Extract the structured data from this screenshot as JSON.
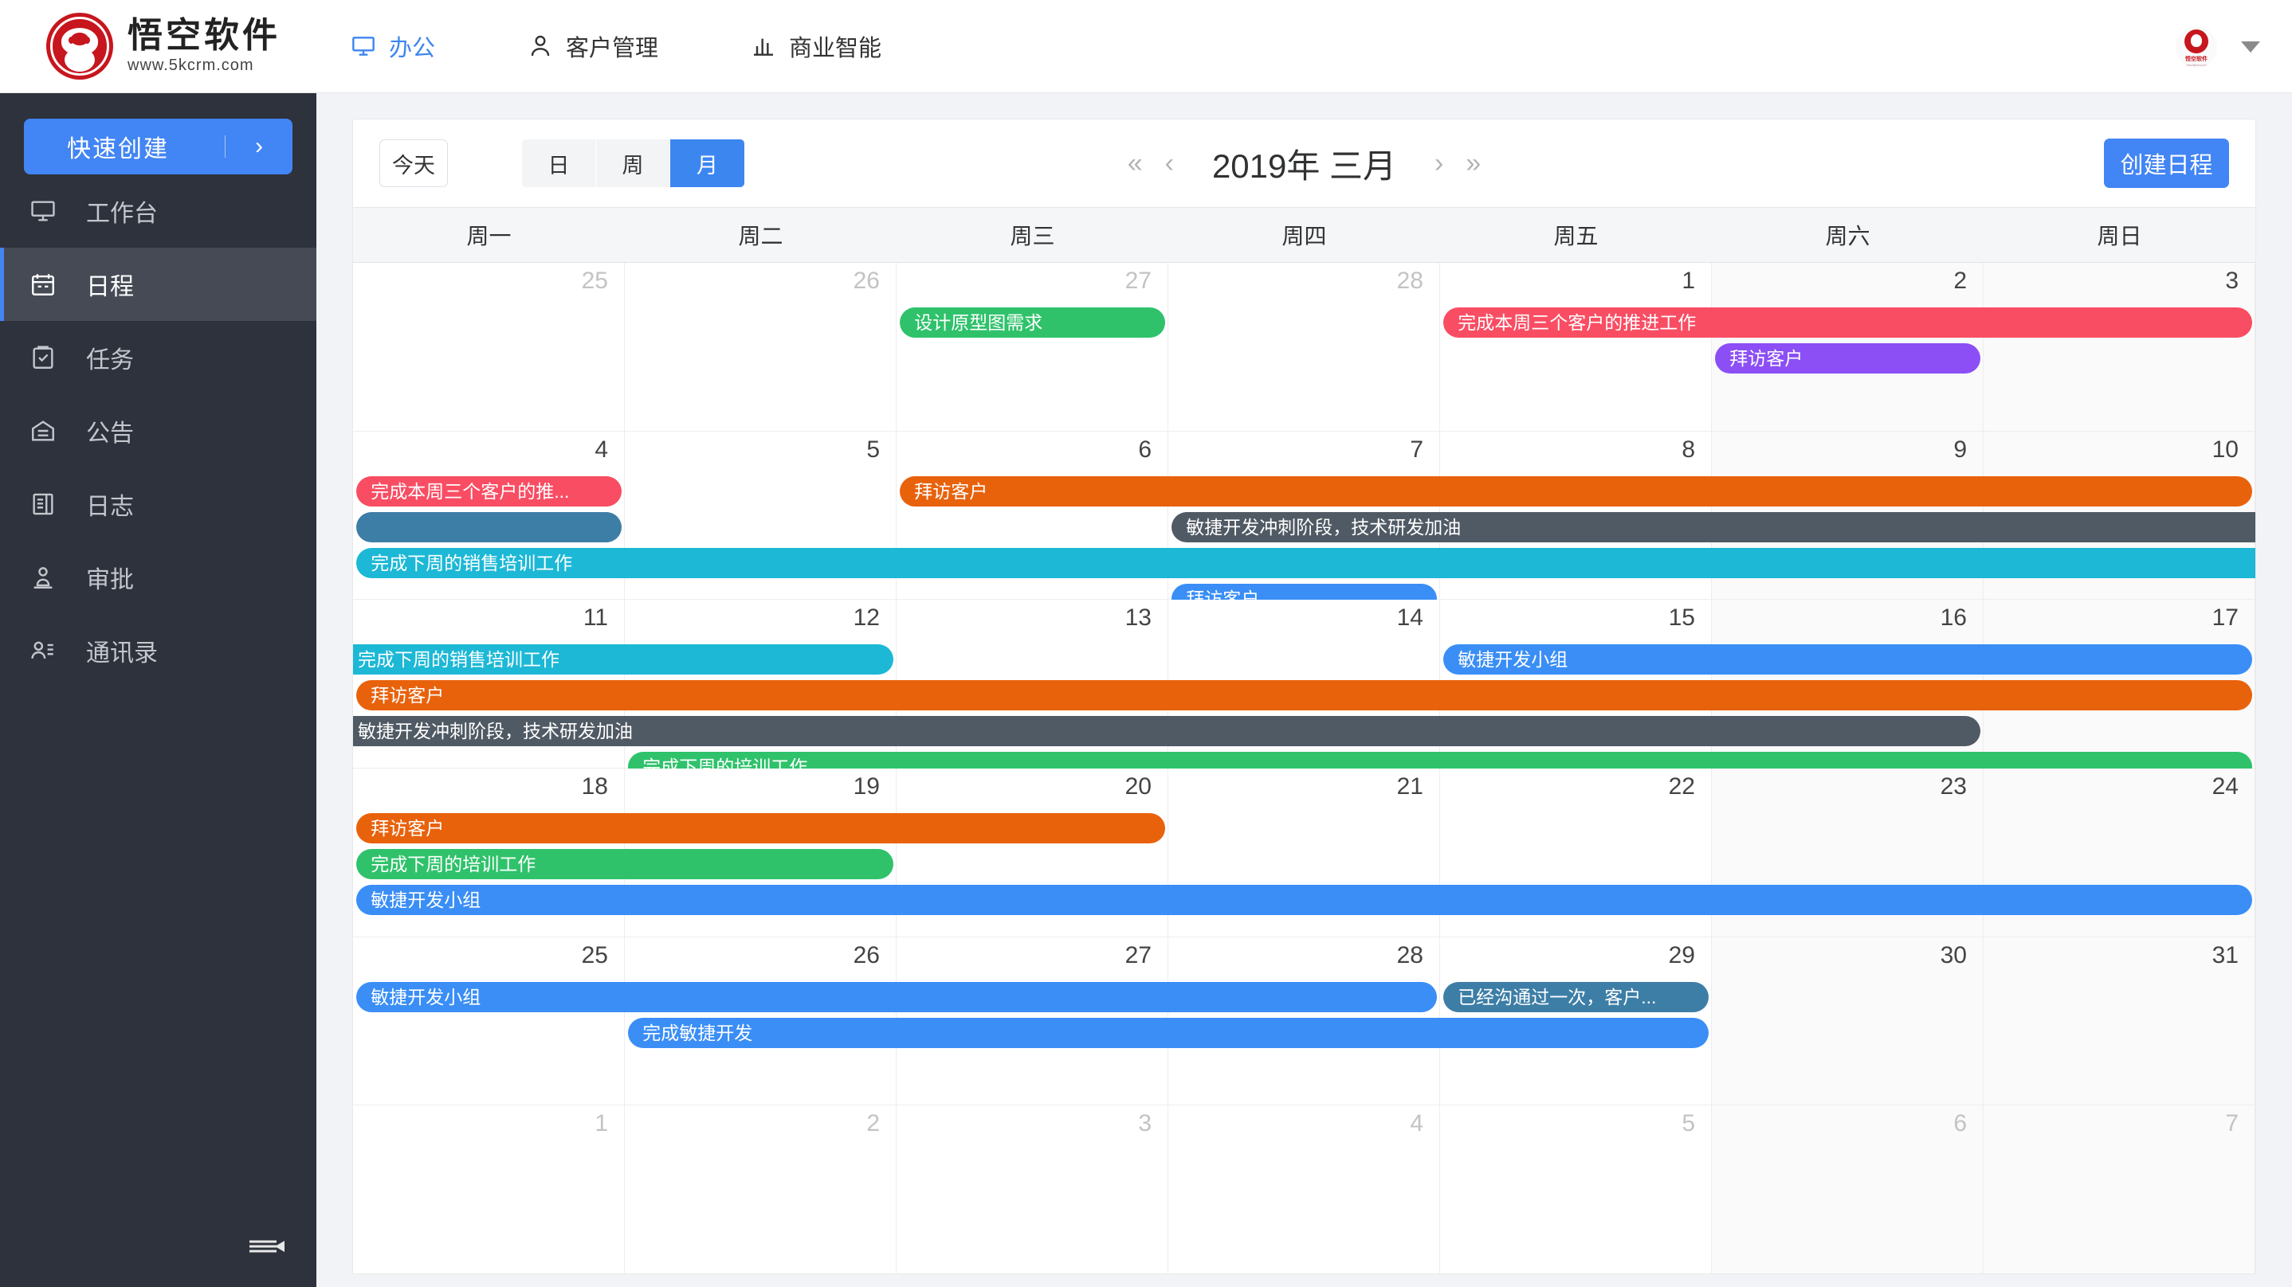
{
  "brand": {
    "name": "悟空软件",
    "url": "www.5kcrm.com",
    "logo_color": "#c7161e"
  },
  "topnav": {
    "items": [
      {
        "label": "办公",
        "icon": "monitor-icon",
        "active": true
      },
      {
        "label": "客户管理",
        "icon": "user-icon",
        "active": false
      },
      {
        "label": "商业智能",
        "icon": "bar-chart-icon",
        "active": false
      }
    ],
    "avatar_label": "悟空软件",
    "avatar_url": "www.5kcrm.com"
  },
  "sidebar": {
    "quick_create": {
      "label": "快速创建",
      "arrow": "›"
    },
    "items": [
      {
        "label": "工作台",
        "icon": "monitor-icon",
        "active": false
      },
      {
        "label": "日程",
        "icon": "calendar-icon",
        "active": true
      },
      {
        "label": "任务",
        "icon": "clipboard-check-icon",
        "active": false
      },
      {
        "label": "公告",
        "icon": "announcement-icon",
        "active": false
      },
      {
        "label": "日志",
        "icon": "journal-icon",
        "active": false
      },
      {
        "label": "审批",
        "icon": "stamp-icon",
        "active": false
      },
      {
        "label": "通讯录",
        "icon": "contacts-icon",
        "active": false
      }
    ],
    "collapse_icon": "collapse-sidebar-icon"
  },
  "toolbar": {
    "today_label": "今天",
    "views": [
      {
        "label": "日",
        "active": false
      },
      {
        "label": "周",
        "active": false
      },
      {
        "label": "月",
        "active": true
      }
    ],
    "prev_year": "«",
    "prev_month": "‹",
    "next_month": "›",
    "next_year": "»",
    "period_title": "2019年 三月",
    "create_label": "创建日程"
  },
  "calendar": {
    "weekdays": [
      "周一",
      "周二",
      "周三",
      "周四",
      "周五",
      "周六",
      "周日"
    ],
    "weeks": [
      {
        "days": [
          {
            "num": "25",
            "other": true,
            "weekend": false
          },
          {
            "num": "26",
            "other": true,
            "weekend": false
          },
          {
            "num": "27",
            "other": true,
            "weekend": false
          },
          {
            "num": "28",
            "other": true,
            "weekend": false
          },
          {
            "num": "1",
            "other": false,
            "weekend": false
          },
          {
            "num": "2",
            "other": false,
            "weekend": true
          },
          {
            "num": "3",
            "other": false,
            "weekend": true
          }
        ],
        "events": [
          {
            "title": "设计原型图需求",
            "color": "#2fc26b",
            "start": 2,
            "span": 1,
            "row": 0,
            "clipLeft": false,
            "clipRight": false
          },
          {
            "title": "完成本周三个客户的推进工作",
            "color": "#f94d63",
            "start": 4,
            "span": 3,
            "row": 0,
            "clipLeft": false,
            "clipRight": false
          },
          {
            "title": "拜访客户",
            "color": "#8b4ff5",
            "start": 5,
            "span": 1,
            "row": 1,
            "clipLeft": false,
            "clipRight": false
          }
        ]
      },
      {
        "days": [
          {
            "num": "4",
            "other": false,
            "weekend": false
          },
          {
            "num": "5",
            "other": false,
            "weekend": false
          },
          {
            "num": "6",
            "other": false,
            "weekend": false
          },
          {
            "num": "7",
            "other": false,
            "weekend": false
          },
          {
            "num": "8",
            "other": false,
            "weekend": false
          },
          {
            "num": "9",
            "other": false,
            "weekend": true
          },
          {
            "num": "10",
            "other": false,
            "weekend": true
          }
        ],
        "events": [
          {
            "title": "完成本周三个客户的推...",
            "color": "#f94d63",
            "start": 0,
            "span": 1,
            "row": 0,
            "clipLeft": false,
            "clipRight": false
          },
          {
            "title": "",
            "color": "#3d7ea6",
            "start": 0,
            "span": 1,
            "row": 1,
            "clipLeft": false,
            "clipRight": false
          },
          {
            "title": "拜访客户",
            "color": "#e8620c",
            "start": 2,
            "span": 5,
            "row": 0,
            "clipLeft": false,
            "clipRight": false
          },
          {
            "title": "敏捷开发冲刺阶段，技术研发加油",
            "color": "#505a64",
            "start": 3,
            "span": 4,
            "row": 1,
            "clipLeft": false,
            "clipRight": true
          },
          {
            "title": "完成下周的销售培训工作",
            "color": "#1cb8d6",
            "start": 0,
            "span": 7,
            "row": 2,
            "clipLeft": false,
            "clipRight": true
          },
          {
            "title": "拜访客户",
            "color": "#3a8ef6",
            "start": 3,
            "span": 1,
            "row": 3,
            "clipLeft": false,
            "clipRight": false
          }
        ]
      },
      {
        "days": [
          {
            "num": "11",
            "other": false,
            "weekend": false
          },
          {
            "num": "12",
            "other": false,
            "weekend": false
          },
          {
            "num": "13",
            "other": false,
            "weekend": false
          },
          {
            "num": "14",
            "other": false,
            "weekend": false
          },
          {
            "num": "15",
            "other": false,
            "weekend": false
          },
          {
            "num": "16",
            "other": false,
            "weekend": true
          },
          {
            "num": "17",
            "other": false,
            "weekend": true
          }
        ],
        "events": [
          {
            "title": "完成下周的销售培训工作",
            "color": "#1cb8d6",
            "start": 0,
            "span": 2,
            "row": 0,
            "clipLeft": true,
            "clipRight": false
          },
          {
            "title": "敏捷开发小组",
            "color": "#3a8ef6",
            "start": 4,
            "span": 3,
            "row": 0,
            "clipLeft": false,
            "clipRight": false
          },
          {
            "title": "拜访客户",
            "color": "#e8620c",
            "start": 0,
            "span": 7,
            "row": 1,
            "clipLeft": false,
            "clipRight": false
          },
          {
            "title": "敏捷开发冲刺阶段，技术研发加油",
            "color": "#505a64",
            "start": 0,
            "span": 6,
            "row": 2,
            "clipLeft": true,
            "clipRight": false
          },
          {
            "title": "完成下周的培训工作",
            "color": "#2fc26b",
            "start": 1,
            "span": 6,
            "row": 3,
            "clipLeft": false,
            "clipRight": false
          }
        ]
      },
      {
        "days": [
          {
            "num": "18",
            "other": false,
            "weekend": false
          },
          {
            "num": "19",
            "other": false,
            "weekend": false
          },
          {
            "num": "20",
            "other": false,
            "weekend": false
          },
          {
            "num": "21",
            "other": false,
            "weekend": false
          },
          {
            "num": "22",
            "other": false,
            "weekend": false
          },
          {
            "num": "23",
            "other": false,
            "weekend": true
          },
          {
            "num": "24",
            "other": false,
            "weekend": true
          }
        ],
        "events": [
          {
            "title": "拜访客户",
            "color": "#e8620c",
            "start": 0,
            "span": 3,
            "row": 0,
            "clipLeft": false,
            "clipRight": false
          },
          {
            "title": "完成下周的培训工作",
            "color": "#2fc26b",
            "start": 0,
            "span": 2,
            "row": 1,
            "clipLeft": false,
            "clipRight": false
          },
          {
            "title": "敏捷开发小组",
            "color": "#3a8ef6",
            "start": 0,
            "span": 7,
            "row": 2,
            "clipLeft": false,
            "clipRight": false
          }
        ]
      },
      {
        "days": [
          {
            "num": "25",
            "other": false,
            "weekend": false
          },
          {
            "num": "26",
            "other": false,
            "weekend": false
          },
          {
            "num": "27",
            "other": false,
            "weekend": false
          },
          {
            "num": "28",
            "other": false,
            "weekend": false
          },
          {
            "num": "29",
            "other": false,
            "weekend": false
          },
          {
            "num": "30",
            "other": false,
            "weekend": true
          },
          {
            "num": "31",
            "other": false,
            "weekend": true
          }
        ],
        "events": [
          {
            "title": "敏捷开发小组",
            "color": "#3a8ef6",
            "start": 0,
            "span": 4,
            "row": 0,
            "clipLeft": false,
            "clipRight": false
          },
          {
            "title": "已经沟通过一次，客户...",
            "color": "#3d7ea6",
            "start": 4,
            "span": 1,
            "row": 0,
            "clipLeft": false,
            "clipRight": false
          },
          {
            "title": "完成敏捷开发",
            "color": "#3a8ef6",
            "start": 1,
            "span": 4,
            "row": 1,
            "clipLeft": false,
            "clipRight": false
          }
        ]
      },
      {
        "days": [
          {
            "num": "1",
            "other": true,
            "weekend": false
          },
          {
            "num": "2",
            "other": true,
            "weekend": false
          },
          {
            "num": "3",
            "other": true,
            "weekend": false
          },
          {
            "num": "4",
            "other": true,
            "weekend": false
          },
          {
            "num": "5",
            "other": true,
            "weekend": false
          },
          {
            "num": "6",
            "other": true,
            "weekend": true
          },
          {
            "num": "7",
            "other": true,
            "weekend": true
          }
        ],
        "events": []
      }
    ]
  }
}
